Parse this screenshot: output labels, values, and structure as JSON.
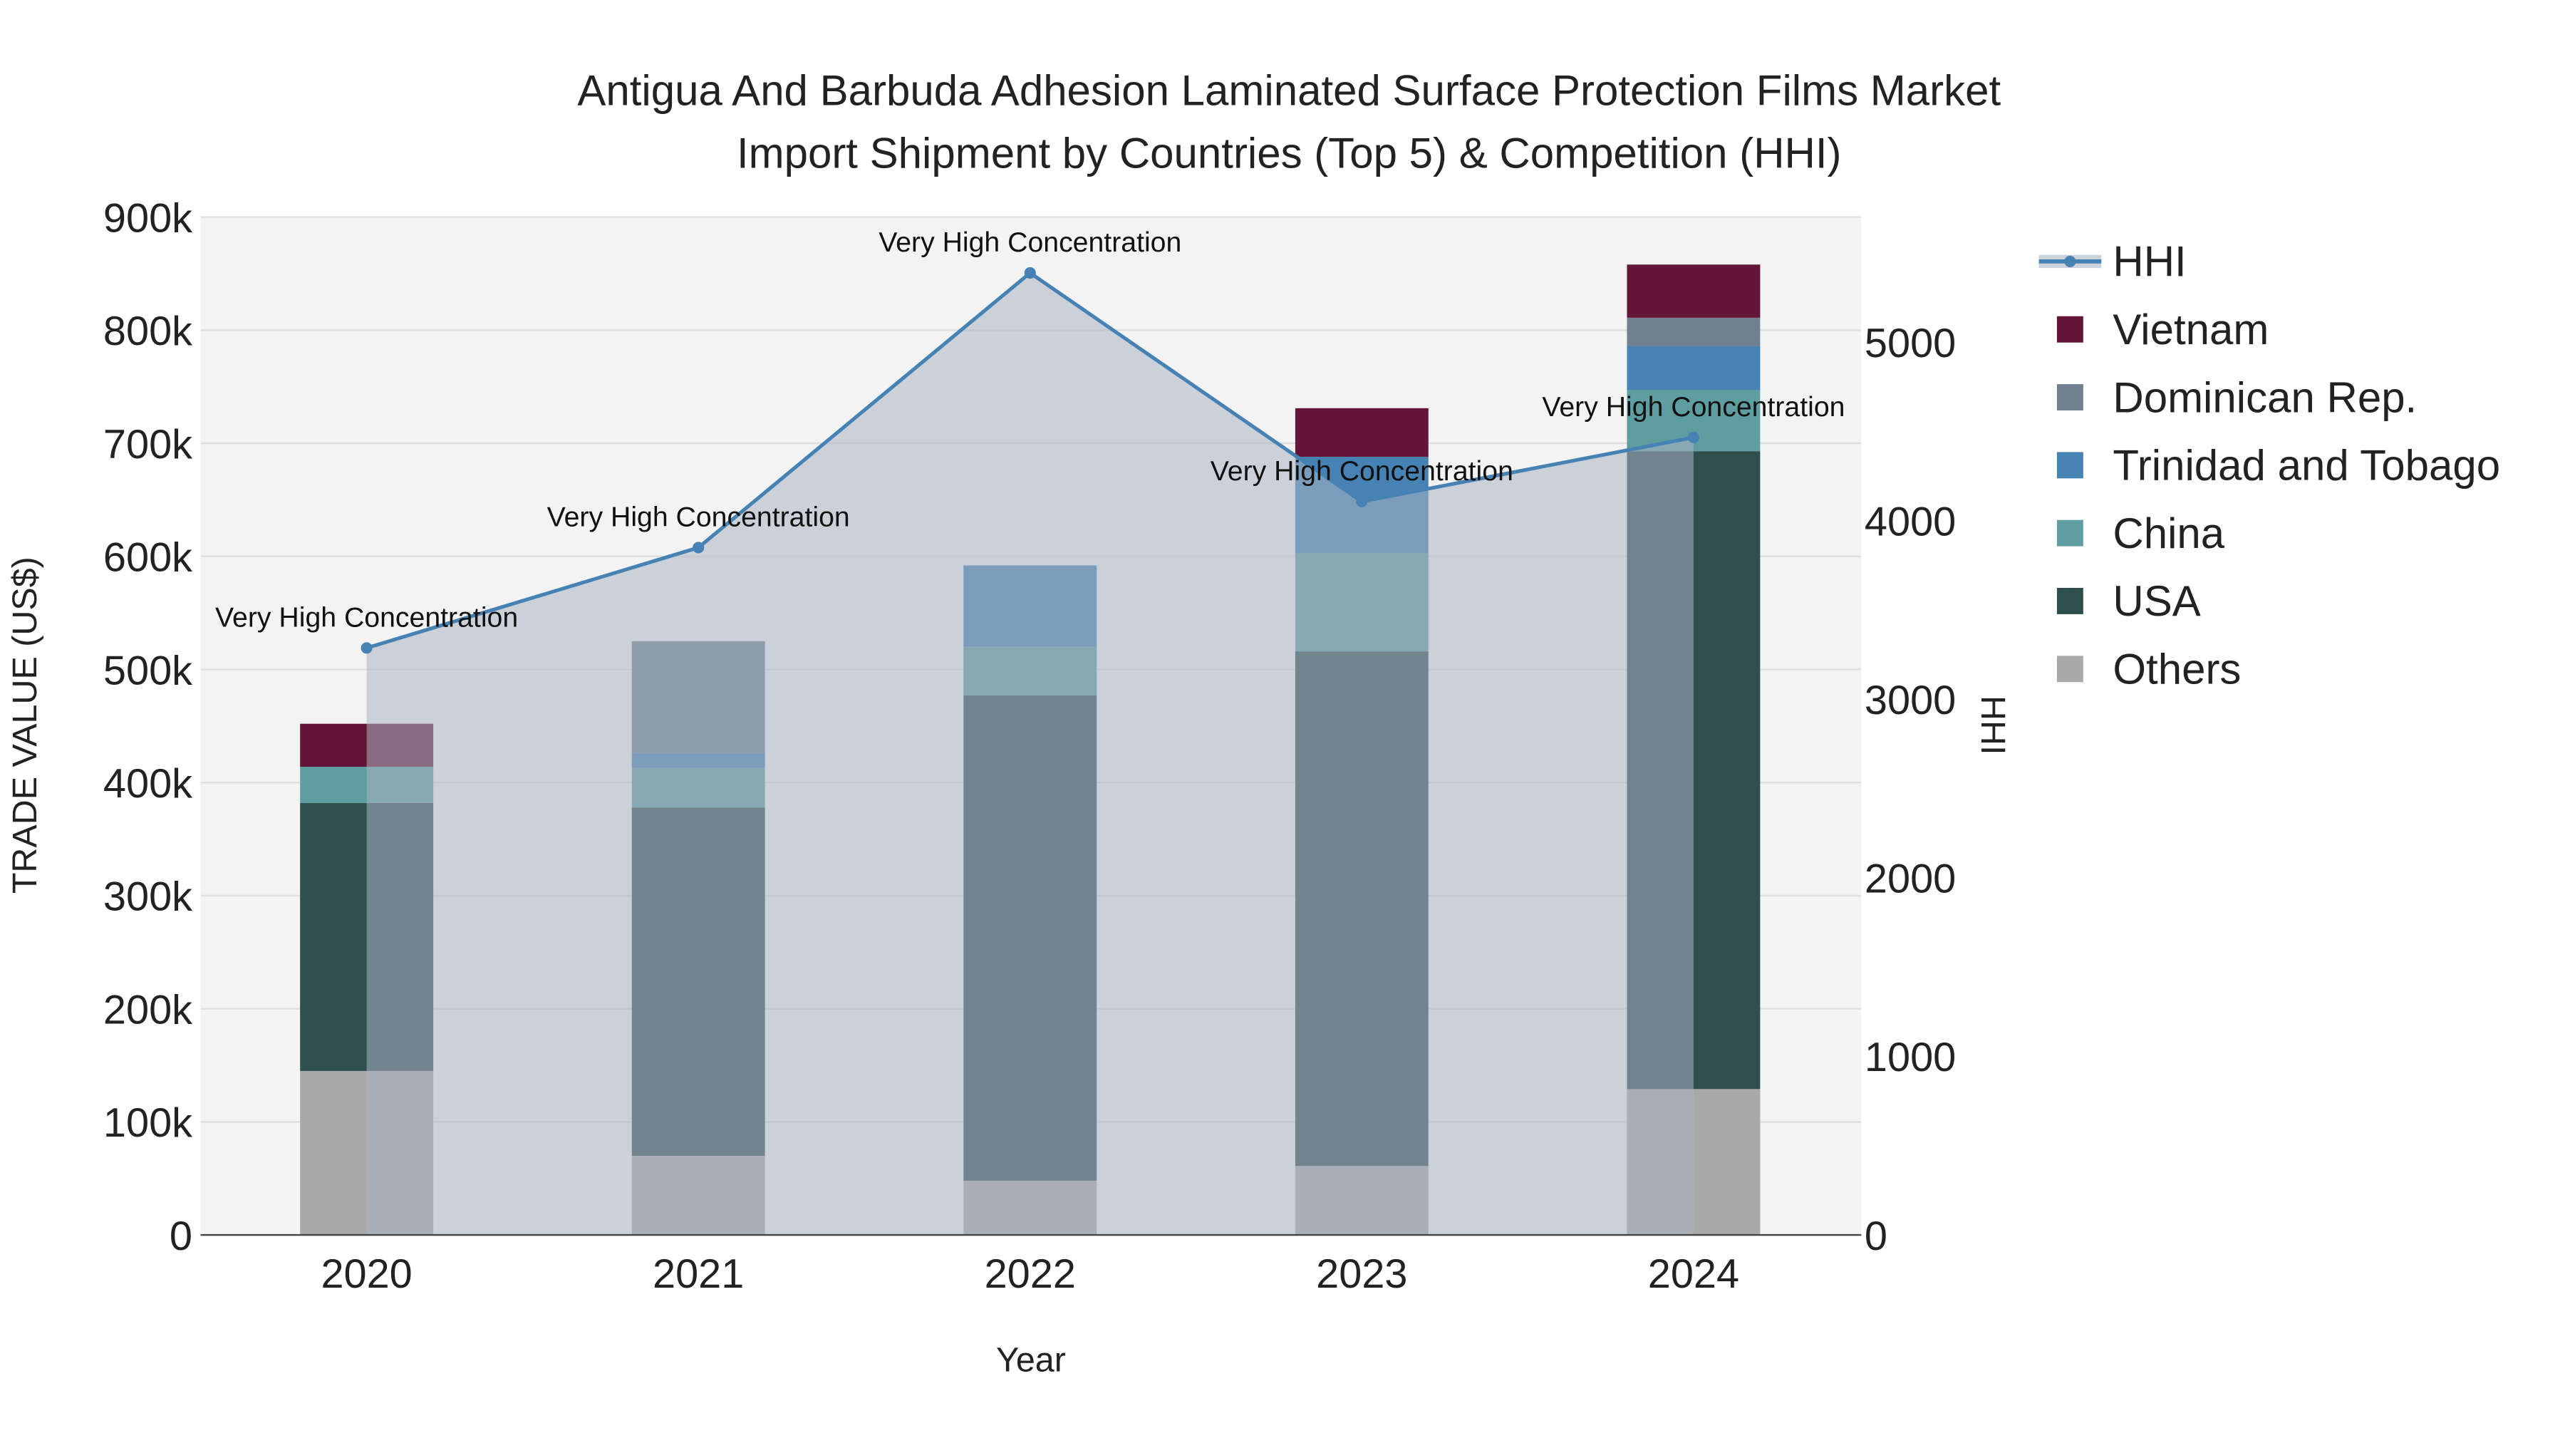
{
  "chart_data": {
    "type": "bar",
    "title_line1": "Antigua And Barbuda Adhesion Laminated Surface Protection Films Market",
    "title_line2": "Import Shipment by Countries (Top 5) & Competition (HHI)",
    "xlabel": "Year",
    "ylabel": "TRADE VALUE (US$)",
    "y2label": "HHI",
    "categories": [
      "2020",
      "2021",
      "2022",
      "2023",
      "2024"
    ],
    "ylim": [
      0,
      900000
    ],
    "y2lim": [
      0,
      5700
    ],
    "yticks": [
      {
        "v": 0,
        "label": "0"
      },
      {
        "v": 100000,
        "label": "100k"
      },
      {
        "v": 200000,
        "label": "200k"
      },
      {
        "v": 300000,
        "label": "300k"
      },
      {
        "v": 400000,
        "label": "400k"
      },
      {
        "v": 500000,
        "label": "500k"
      },
      {
        "v": 600000,
        "label": "600k"
      },
      {
        "v": 700000,
        "label": "700k"
      },
      {
        "v": 800000,
        "label": "800k"
      },
      {
        "v": 900000,
        "label": "900k"
      }
    ],
    "y2ticks": [
      {
        "v": 0,
        "label": "0"
      },
      {
        "v": 1000,
        "label": "1000"
      },
      {
        "v": 2000,
        "label": "2000"
      },
      {
        "v": 3000,
        "label": "3000"
      },
      {
        "v": 4000,
        "label": "4000"
      },
      {
        "v": 5000,
        "label": "5000"
      }
    ],
    "series": [
      {
        "name": "Others",
        "color": "#a9a9a9",
        "values": [
          145000,
          70000,
          48000,
          61000,
          129000
        ]
      },
      {
        "name": "USA",
        "color": "#2f4f4f",
        "values": [
          237000,
          308000,
          429000,
          455000,
          564000
        ]
      },
      {
        "name": "China",
        "color": "#5f9ea0",
        "values": [
          32000,
          35000,
          43000,
          87000,
          54000
        ]
      },
      {
        "name": "Trinidad and Tobago",
        "color": "#4682b4",
        "values": [
          0,
          13000,
          72000,
          85000,
          39000
        ]
      },
      {
        "name": "Dominican Rep.",
        "color": "#708090",
        "values": [
          0,
          99000,
          0,
          0,
          25000
        ]
      },
      {
        "name": "Vietnam",
        "color": "#641638",
        "values": [
          38000,
          0,
          0,
          43000,
          47000
        ]
      }
    ],
    "hhi": {
      "name": "HHI",
      "color": "#4682b4",
      "values": [
        3287,
        3849,
        5387,
        4107,
        4466
      ],
      "annotations": [
        "Very High Concentration",
        "Very High Concentration",
        "Very High Concentration",
        "Very High Concentration",
        "Very High Concentration"
      ]
    },
    "legend": [
      "HHI",
      "Vietnam",
      "Dominican Rep.",
      "Trinidad and Tobago",
      "China",
      "USA",
      "Others"
    ],
    "legend_placement": "right",
    "grid": true
  }
}
